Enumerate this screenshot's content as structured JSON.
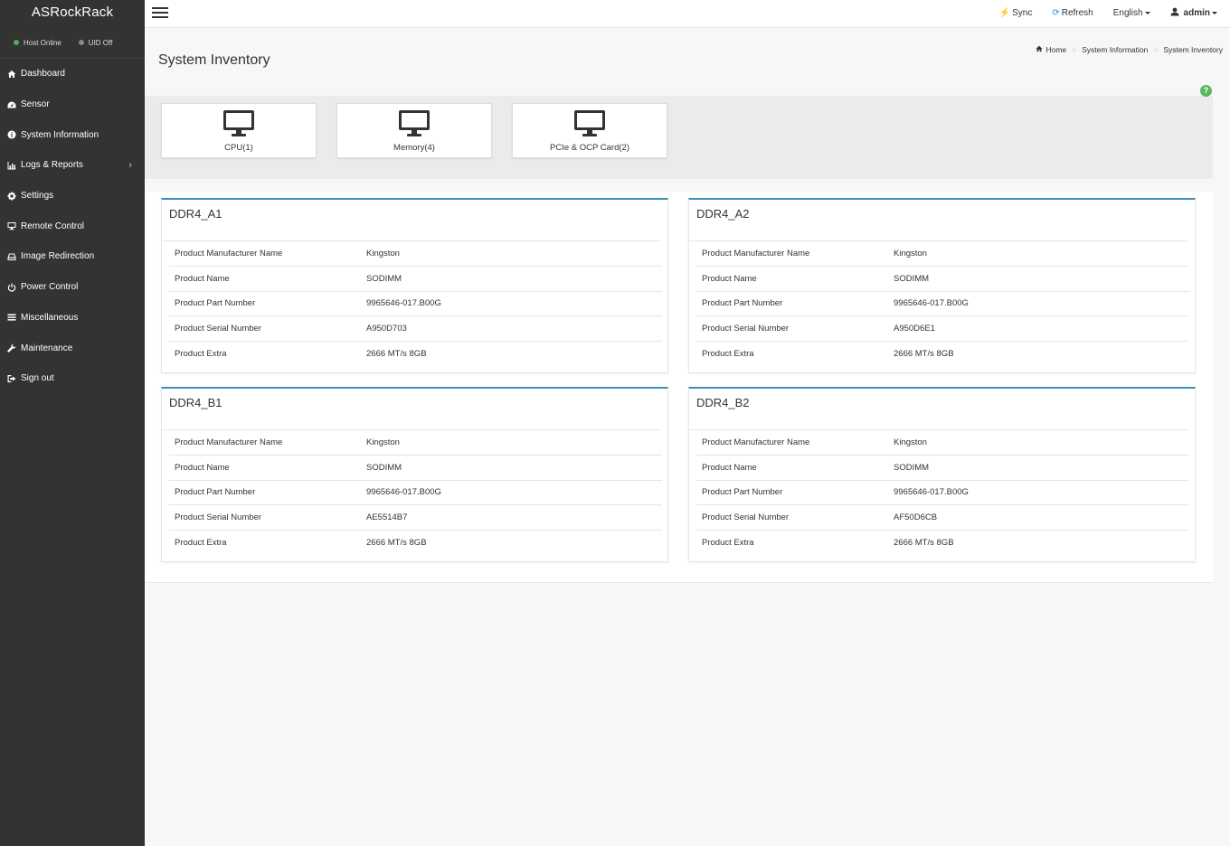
{
  "sidebar": {
    "brand": "ASRockRack",
    "status": {
      "host": "Host Online",
      "uid": "UID Off"
    },
    "items": [
      {
        "label": "Dashboard",
        "icon": "home-icon"
      },
      {
        "label": "Sensor",
        "icon": "gauge-icon"
      },
      {
        "label": "System Information",
        "icon": "info-icon"
      },
      {
        "label": "Logs & Reports",
        "icon": "bar-chart-icon"
      },
      {
        "label": "Settings",
        "icon": "gear-icon"
      },
      {
        "label": "Remote Control",
        "icon": "desktop-icon"
      },
      {
        "label": "Image Redirection",
        "icon": "hdd-icon"
      },
      {
        "label": "Power Control",
        "icon": "power-icon"
      },
      {
        "label": "Miscellaneous",
        "icon": "list-icon"
      },
      {
        "label": "Maintenance",
        "icon": "wrench-icon"
      },
      {
        "label": "Sign out",
        "icon": "sign-out-icon"
      }
    ]
  },
  "topbar": {
    "sync": "Sync",
    "refresh": "Refresh",
    "language": "English",
    "user": "admin",
    "accent": "#2b8fd6"
  },
  "page": {
    "title": "System Inventory",
    "breadcrumb": [
      "Home",
      "System Information",
      "System Inventory"
    ]
  },
  "tiles": [
    {
      "label": "CPU(1)"
    },
    {
      "label": "Memory(4)"
    },
    {
      "label": "PCIe & OCP Card(2)"
    }
  ],
  "modules": [
    {
      "title": "DDR4_A1",
      "rows": [
        {
          "key": "Product Manufacturer Name",
          "value": "Kingston"
        },
        {
          "key": "Product Name",
          "value": "SODIMM"
        },
        {
          "key": "Product Part Number",
          "value": "9965646-017.B00G"
        },
        {
          "key": "Product Serial Number",
          "value": "A950D703"
        },
        {
          "key": "Product Extra",
          "value": "2666 MT/s 8GB"
        }
      ]
    },
    {
      "title": "DDR4_A2",
      "rows": [
        {
          "key": "Product Manufacturer Name",
          "value": "Kingston"
        },
        {
          "key": "Product Name",
          "value": "SODIMM"
        },
        {
          "key": "Product Part Number",
          "value": "9965646-017.B00G"
        },
        {
          "key": "Product Serial Number",
          "value": "A950D6E1"
        },
        {
          "key": "Product Extra",
          "value": "2666 MT/s 8GB"
        }
      ]
    },
    {
      "title": "DDR4_B1",
      "rows": [
        {
          "key": "Product Manufacturer Name",
          "value": "Kingston"
        },
        {
          "key": "Product Name",
          "value": "SODIMM"
        },
        {
          "key": "Product Part Number",
          "value": "9965646-017.B00G"
        },
        {
          "key": "Product Serial Number",
          "value": "AE5514B7"
        },
        {
          "key": "Product Extra",
          "value": "2666 MT/s 8GB"
        }
      ]
    },
    {
      "title": "DDR4_B2",
      "rows": [
        {
          "key": "Product Manufacturer Name",
          "value": "Kingston"
        },
        {
          "key": "Product Name",
          "value": "SODIMM"
        },
        {
          "key": "Product Part Number",
          "value": "9965646-017.B00G"
        },
        {
          "key": "Product Serial Number",
          "value": "AF50D6CB"
        },
        {
          "key": "Product Extra",
          "value": "2666 MT/s 8GB"
        }
      ]
    }
  ]
}
